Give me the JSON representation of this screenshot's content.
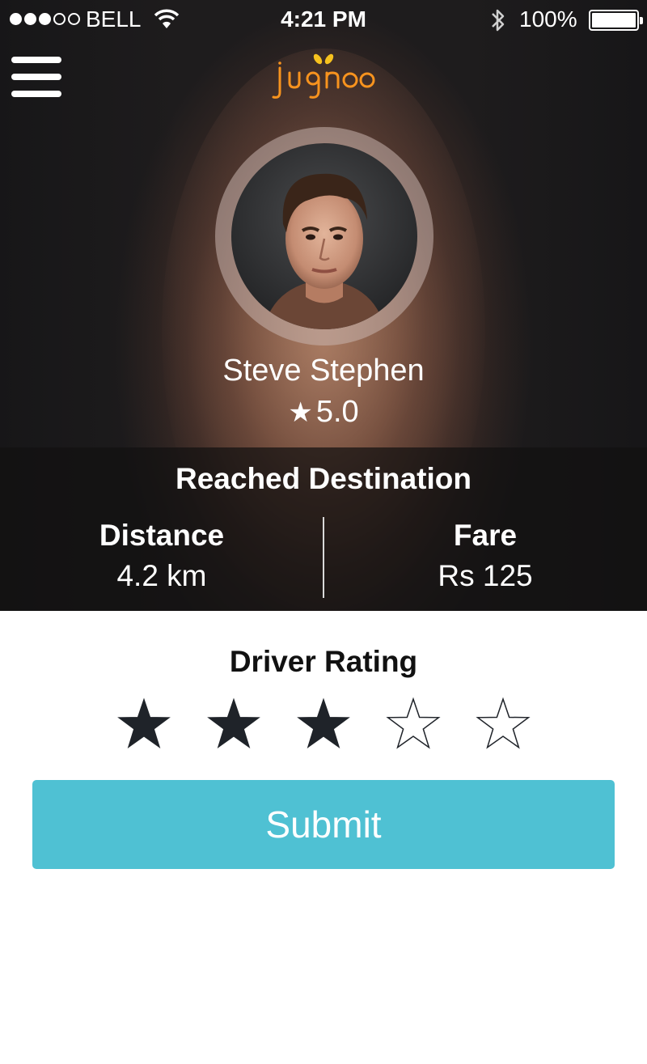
{
  "status_bar": {
    "carrier": "BELL",
    "time": "4:21 PM",
    "battery": "100%",
    "signal_bars_filled": 3,
    "signal_bars_total": 5
  },
  "nav": {
    "menu_icon": "hamburger-menu-icon",
    "logo_text": "jugnoo"
  },
  "driver": {
    "name": "Steve Stephen",
    "rating_icon": "star-icon",
    "rating": "5.0"
  },
  "trip": {
    "status": "Reached Destination",
    "distance_label": "Distance",
    "distance_value": "4.2 km",
    "fare_label": "Fare",
    "fare_value": "Rs 125"
  },
  "rating": {
    "title": "Driver Rating",
    "selected": 3,
    "max": 5
  },
  "submit_label": "Submit",
  "colors": {
    "accent": "#4fc1d3",
    "logo_orange": "#f7931e",
    "star_filled": "#1f2329"
  }
}
